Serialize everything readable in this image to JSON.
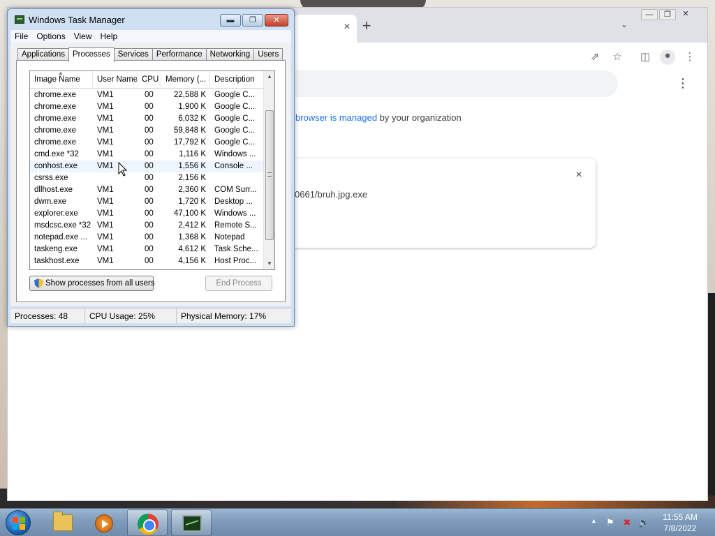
{
  "chrome": {
    "tab_close": "×",
    "new_tab": "+",
    "tab_list": "⌄",
    "managed_link": "browser is managed",
    "managed_rest": " by your organization",
    "download_path": "0661/bruh.jpg.exe",
    "download_close": "×",
    "menu_kebab": "⋮"
  },
  "taskmanager": {
    "title": "Windows Task Manager",
    "menus": [
      "File",
      "Options",
      "View",
      "Help"
    ],
    "tabs": [
      "Applications",
      "Processes",
      "Services",
      "Performance",
      "Networking",
      "Users"
    ],
    "active_tab": "Processes",
    "columns": {
      "name": "Image Name",
      "user": "User Name",
      "cpu": "CPU",
      "memory": "Memory (...",
      "description": "Description"
    },
    "rows": [
      {
        "name": "chrome.exe",
        "user": "VM1",
        "cpu": "00",
        "mem": "22,588 K",
        "desc": "Google C..."
      },
      {
        "name": "chrome.exe",
        "user": "VM1",
        "cpu": "00",
        "mem": "1,900 K",
        "desc": "Google C..."
      },
      {
        "name": "chrome.exe",
        "user": "VM1",
        "cpu": "00",
        "mem": "6,032 K",
        "desc": "Google C..."
      },
      {
        "name": "chrome.exe",
        "user": "VM1",
        "cpu": "00",
        "mem": "59,848 K",
        "desc": "Google C..."
      },
      {
        "name": "chrome.exe",
        "user": "VM1",
        "cpu": "00",
        "mem": "17,792 K",
        "desc": "Google C..."
      },
      {
        "name": "cmd.exe *32",
        "user": "VM1",
        "cpu": "00",
        "mem": "1,116 K",
        "desc": "Windows ..."
      },
      {
        "name": "conhost.exe",
        "user": "VM1",
        "cpu": "00",
        "mem": "1,556 K",
        "desc": "Console ..."
      },
      {
        "name": "csrss.exe",
        "user": "",
        "cpu": "00",
        "mem": "2,156 K",
        "desc": ""
      },
      {
        "name": "dllhost.exe",
        "user": "VM1",
        "cpu": "00",
        "mem": "2,360 K",
        "desc": "COM Surr..."
      },
      {
        "name": "dwm.exe",
        "user": "VM1",
        "cpu": "00",
        "mem": "1,720 K",
        "desc": "Desktop ..."
      },
      {
        "name": "explorer.exe",
        "user": "VM1",
        "cpu": "00",
        "mem": "47,100 K",
        "desc": "Windows ..."
      },
      {
        "name": "msdcsc.exe *32",
        "user": "VM1",
        "cpu": "00",
        "mem": "2,412 K",
        "desc": "Remote S..."
      },
      {
        "name": "notepad.exe ...",
        "user": "VM1",
        "cpu": "00",
        "mem": "1,368 K",
        "desc": "Notepad"
      },
      {
        "name": "taskeng.exe",
        "user": "VM1",
        "cpu": "00",
        "mem": "4,612 K",
        "desc": "Task Sche..."
      },
      {
        "name": "taskhost.exe",
        "user": "VM1",
        "cpu": "00",
        "mem": "4,156 K",
        "desc": "Host Proc..."
      }
    ],
    "hover_row_index": 6,
    "show_all_button": "Show processes from all users",
    "end_process_button": "End Process",
    "status": {
      "processes": "Processes: 48",
      "cpu": "CPU Usage: 25%",
      "memory": "Physical Memory: 17%"
    }
  },
  "taskbar": {
    "clock_time": "11:55 AM",
    "clock_date": "7/8/2022",
    "items": [
      "windows-explorer",
      "windows-media-player",
      "google-chrome",
      "task-manager"
    ]
  }
}
